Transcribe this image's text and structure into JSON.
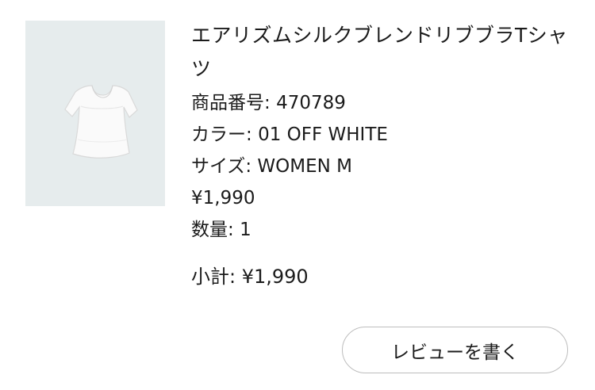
{
  "product": {
    "name": "エアリズムシルクブレンドリブブラTシャツ",
    "item_number_label": "商品番号",
    "item_number": "470789",
    "color_label": "カラー",
    "color_value": "01 OFF WHITE",
    "size_label": "サイズ",
    "size_value": "WOMEN M",
    "price": "¥1,990",
    "quantity_label": "数量",
    "quantity_value": "1",
    "subtotal_label": "小計",
    "subtotal_value": "¥1,990",
    "image_icon": "white-tshirt-product-image",
    "image_bg": "#e6eced"
  },
  "actions": {
    "write_review_label": "レビューを書く"
  }
}
